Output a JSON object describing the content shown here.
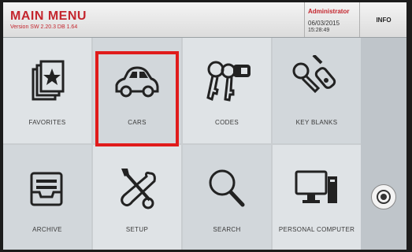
{
  "header": {
    "title": "MAIN MENU",
    "version": "Version SW 2.20.3 DB 1.64",
    "user": "Administrator",
    "date": "06/03/2015",
    "time": "15:28:49",
    "info_label": "INFO"
  },
  "tiles": [
    {
      "label": "FAVORITES",
      "icon": "favorites-icon"
    },
    {
      "label": "CARS",
      "icon": "car-icon"
    },
    {
      "label": "CODES",
      "icon": "keys-icon"
    },
    {
      "label": "KEY BLANKS",
      "icon": "key-blanks-icon"
    },
    {
      "label": "ARCHIVE",
      "icon": "archive-icon"
    },
    {
      "label": "SETUP",
      "icon": "setup-icon"
    },
    {
      "label": "SEARCH",
      "icon": "search-icon"
    },
    {
      "label": "PERSONAL COMPUTER",
      "icon": "computer-icon"
    }
  ],
  "power": {
    "icon": "power-icon"
  },
  "colors": {
    "accent": "#c4262e",
    "highlight": "#e01b1b"
  }
}
